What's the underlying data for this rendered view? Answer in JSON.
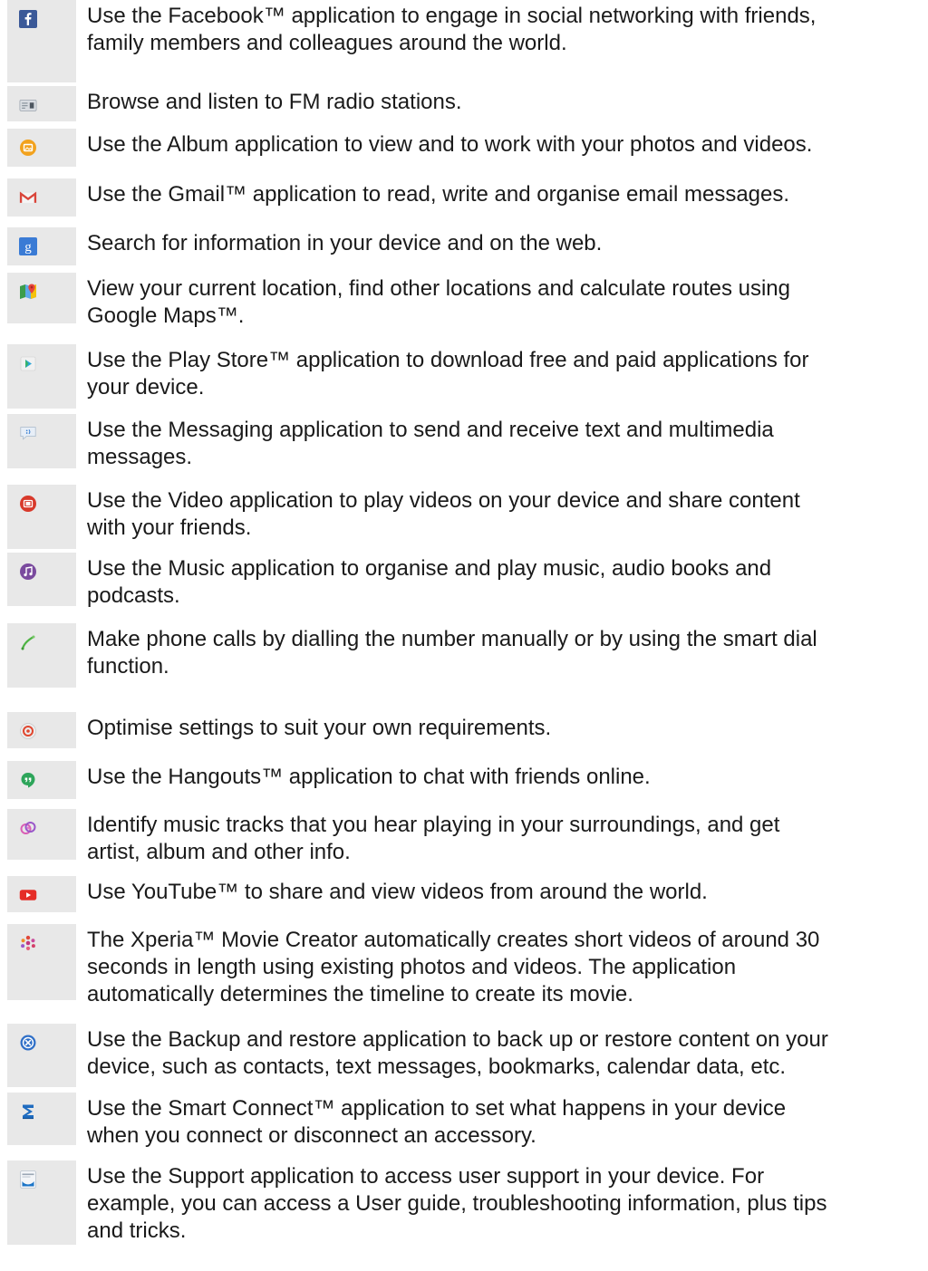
{
  "apps": [
    {
      "icon": "facebook-icon",
      "text": [
        "Use the Facebook™ application to engage in social networking with friends,",
        "family members and colleagues around the world."
      ]
    },
    {
      "icon": "fm-radio-icon",
      "text": [
        "Browse and listen to FM radio stations."
      ]
    },
    {
      "icon": "album-icon",
      "text": [
        "Use the Album application to view and to work with your photos and videos."
      ]
    },
    {
      "icon": "gmail-icon",
      "text": [
        "Use the Gmail™ application to read, write and organise email messages."
      ]
    },
    {
      "icon": "google-search-icon",
      "text": [
        "Search for information in your device and on the web."
      ]
    },
    {
      "icon": "google-maps-icon",
      "text": [
        "View your current location, find other locations and calculate routes using",
        "Google Maps™."
      ]
    },
    {
      "icon": "play-store-icon",
      "text": [
        "Use the Play Store™ application to download free and paid applications for",
        "your device."
      ]
    },
    {
      "icon": "messaging-icon",
      "text": [
        "Use the Messaging application to send and receive text and multimedia",
        "messages."
      ]
    },
    {
      "icon": "video-icon",
      "text": [
        "Use the Video application to play videos on your device and share content",
        "with your friends."
      ]
    },
    {
      "icon": "music-icon",
      "text": [
        "Use the Music application to organise and play music, audio books and",
        "podcasts."
      ]
    },
    {
      "icon": "phone-icon",
      "text": [
        "Make phone calls by dialling the number manually or by using the smart dial",
        "function."
      ]
    },
    {
      "icon": "settings-icon",
      "text": [
        "Optimise settings to suit your own requirements."
      ]
    },
    {
      "icon": "hangouts-icon",
      "text": [
        "Use the Hangouts™ application to chat with friends online."
      ]
    },
    {
      "icon": "trackid-icon",
      "text": [
        "Identify music tracks that you hear playing in your surroundings, and get",
        "artist, album and other info."
      ]
    },
    {
      "icon": "youtube-icon",
      "text": [
        "Use YouTube™ to share and view videos from around the world."
      ]
    },
    {
      "icon": "movie-creator-icon",
      "text": [
        "The Xperia™ Movie Creator automatically creates short videos of around 30",
        "seconds in length using existing photos and videos. The application",
        "automatically determines the timeline to create its movie."
      ]
    },
    {
      "icon": "backup-restore-icon",
      "text": [
        "Use the Backup and restore application to back up or restore content on your",
        "device, such as contacts, text messages, bookmarks, calendar data, etc."
      ]
    },
    {
      "icon": "smart-connect-icon",
      "text": [
        "Use the Smart Connect™ application to set what happens in your device",
        "when you connect or disconnect an accessory."
      ]
    },
    {
      "icon": "support-icon",
      "text": [
        "Use the Support application to access user support in your device. For",
        "example, you can access a User guide, troubleshooting information, plus tips",
        "and tricks."
      ]
    }
  ],
  "colors": {
    "facebook": "#3b5998",
    "gmail": "#d9453a",
    "youtube": "#e52d27",
    "video": "#d8392b",
    "music": "#7a4a9e",
    "hangouts": "#2da55a",
    "album": "#f2a21e",
    "google": "#3a7bd5",
    "backup": "#2f6fc7",
    "smart_connect": "#1f6cc0"
  }
}
